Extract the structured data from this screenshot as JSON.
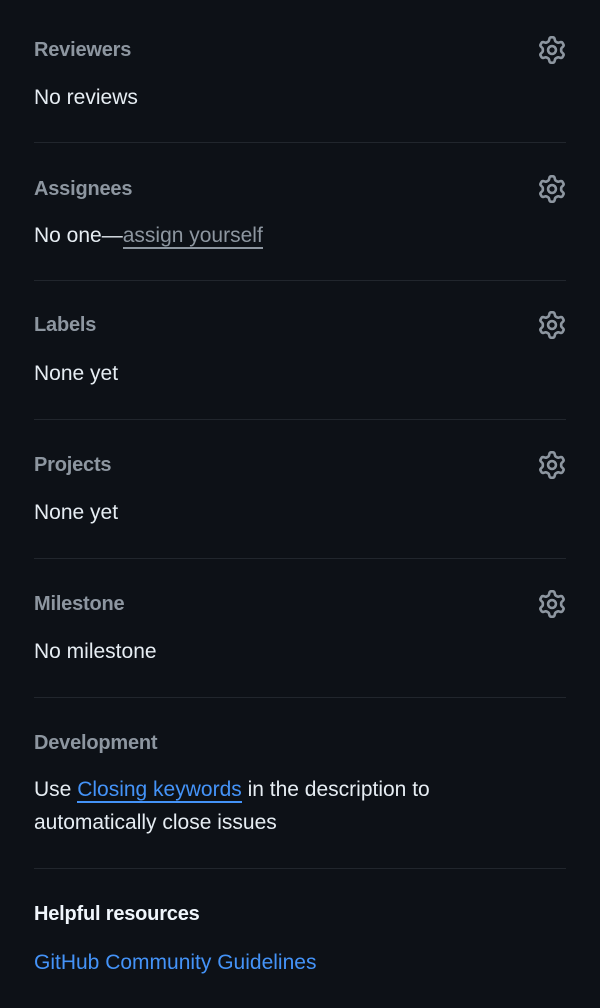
{
  "sections": {
    "reviewers": {
      "title": "Reviewers",
      "value": "No reviews",
      "icon": "gear-icon"
    },
    "assignees": {
      "title": "Assignees",
      "value_prefix": "No one—",
      "value_link": "assign yourself",
      "icon": "gear-icon"
    },
    "labels": {
      "title": "Labels",
      "value": "None yet",
      "icon": "gear-icon"
    },
    "projects": {
      "title": "Projects",
      "value": "None yet",
      "icon": "gear-icon"
    },
    "milestone": {
      "title": "Milestone",
      "value": "No milestone",
      "icon": "gear-icon"
    },
    "development": {
      "title": "Development",
      "text_before": "Use ",
      "link": "Closing keywords",
      "text_after": " in the description to automatically close issues"
    }
  },
  "helpful_resources": {
    "title": "Helpful resources",
    "links": [
      "GitHub Community Guidelines"
    ]
  },
  "colors": {
    "background": "#0d1117",
    "heading": "#8d96a0",
    "text": "#e6edf3",
    "link": "#4493f8",
    "divider": "#21262d"
  }
}
